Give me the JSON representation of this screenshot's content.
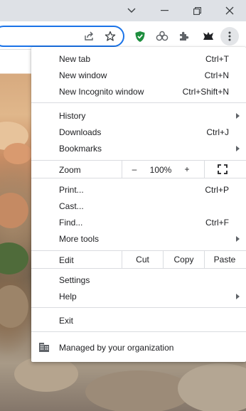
{
  "window_controls": {
    "tab_search": "chevron-down-icon",
    "minimize": "minimize-icon",
    "restore": "restore-icon",
    "close": "close-icon"
  },
  "toolbar_icons": [
    "share-icon",
    "bookmark-star-icon",
    "shield-extension-icon",
    "link-extension-icon",
    "puzzle-extensions-icon",
    "profile-extension-icon",
    "more-menu-icon"
  ],
  "menu": {
    "group1": [
      {
        "label": "New tab",
        "shortcut": "Ctrl+T"
      },
      {
        "label": "New window",
        "shortcut": "Ctrl+N"
      },
      {
        "label": "New Incognito window",
        "shortcut": "Ctrl+Shift+N"
      }
    ],
    "group2": [
      {
        "label": "History",
        "shortcut": "",
        "submenu": true
      },
      {
        "label": "Downloads",
        "shortcut": "Ctrl+J",
        "submenu": false
      },
      {
        "label": "Bookmarks",
        "shortcut": "",
        "submenu": true
      }
    ],
    "zoom": {
      "label": "Zoom",
      "minus": "–",
      "value": "100%",
      "plus": "+"
    },
    "group3": [
      {
        "label": "Print...",
        "shortcut": "Ctrl+P",
        "submenu": false
      },
      {
        "label": "Cast...",
        "shortcut": "",
        "submenu": false
      },
      {
        "label": "Find...",
        "shortcut": "Ctrl+F",
        "submenu": false
      },
      {
        "label": "More tools",
        "shortcut": "",
        "submenu": true
      }
    ],
    "edit": {
      "label": "Edit",
      "cut": "Cut",
      "copy": "Copy",
      "paste": "Paste"
    },
    "group4": [
      {
        "label": "Settings",
        "submenu": false
      },
      {
        "label": "Help",
        "submenu": true
      }
    ],
    "exit": "Exit",
    "managed": "Managed by your organization"
  },
  "colors": {
    "accent": "#1a73e8",
    "shield_green": "#1e8e3e",
    "menu_bg": "#ffffff",
    "separator": "#dadce0"
  }
}
